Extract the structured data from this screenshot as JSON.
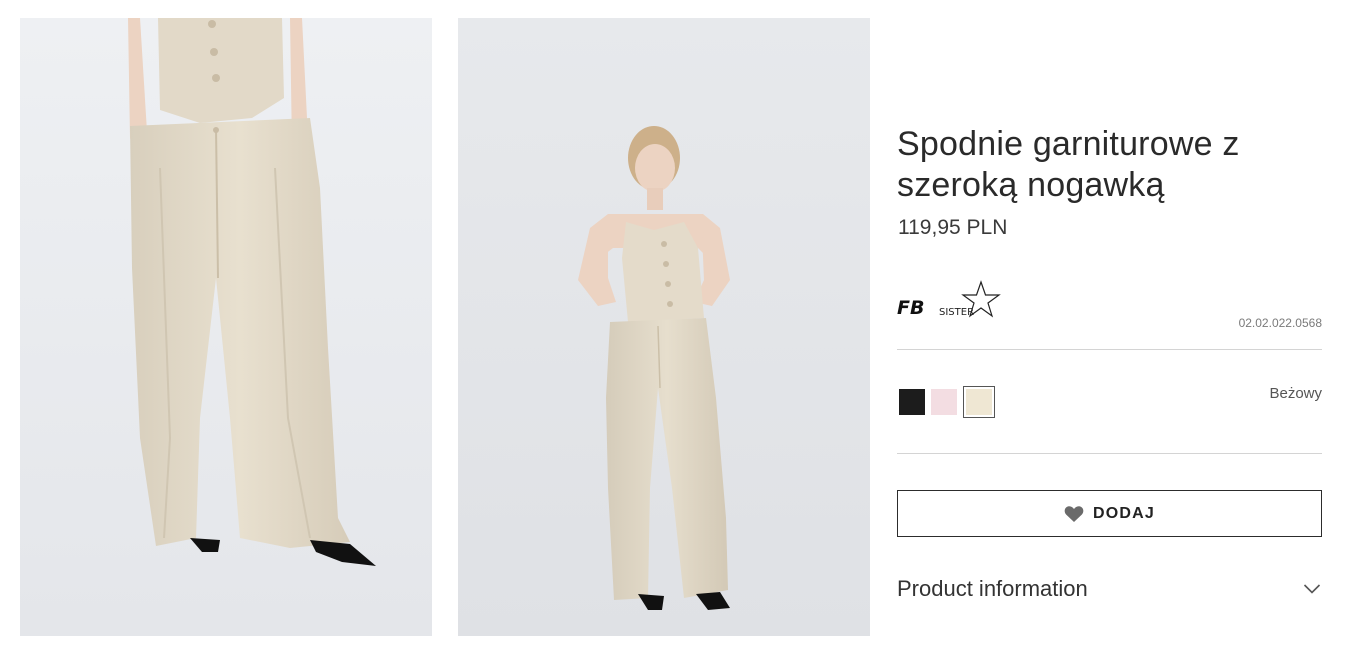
{
  "product": {
    "title": "Spodnie garniturowe z szeroką nogawką",
    "price": "119,95 PLN",
    "sku": "02.02.022.0568"
  },
  "brand": {
    "logo_text_main": "FB",
    "logo_text_sub": "SISTER"
  },
  "colors": {
    "selected_name": "Beżowy",
    "swatches": [
      {
        "name": "black",
        "hex": "#1c1c1c"
      },
      {
        "name": "pink",
        "hex": "#f3dde2"
      },
      {
        "name": "beige",
        "hex": "#efe7d3"
      }
    ]
  },
  "actions": {
    "add_label": "DODAJ"
  },
  "accordion": {
    "product_info_label": "Product information"
  },
  "palette": {
    "garment": "#e5dccb",
    "background_studio": "#e9ebee",
    "shoe": "#111111"
  }
}
